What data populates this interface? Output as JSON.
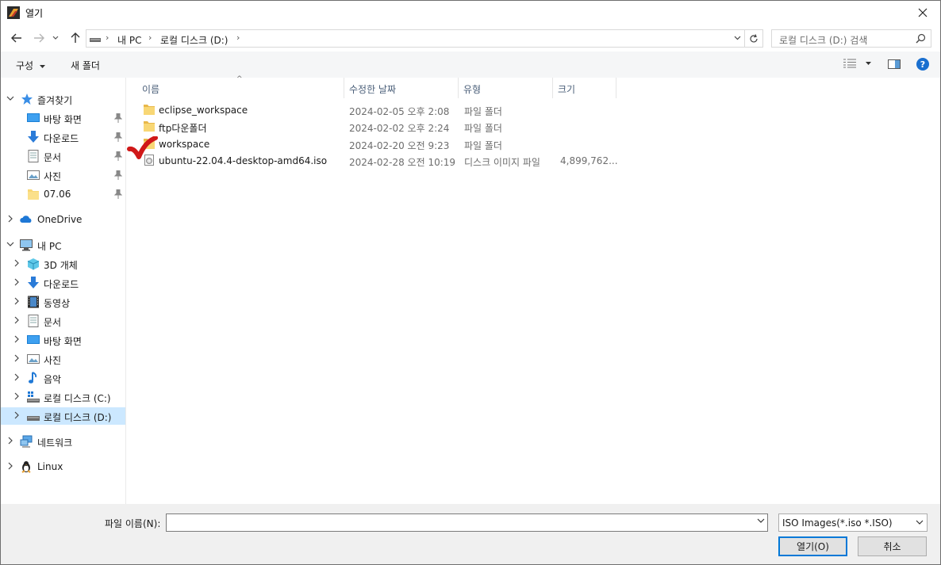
{
  "window": {
    "title": "열기"
  },
  "address": {
    "segments": [
      "내 PC",
      "로컬 디스크 (D:)"
    ]
  },
  "search": {
    "placeholder": "로컬 디스크 (D:) 검색"
  },
  "toolbar": {
    "organize": "구성",
    "new_folder": "새 폴더"
  },
  "sidebar": {
    "quick_access": "즐겨찾기",
    "quick_items": [
      "바탕 화면",
      "다운로드",
      "문서",
      "사진",
      "07.06"
    ],
    "onedrive": "OneDrive",
    "this_pc": "내 PC",
    "pc_items": [
      "3D 개체",
      "다운로드",
      "동영상",
      "문서",
      "바탕 화면",
      "사진",
      "음악",
      "로컬 디스크 (C:)",
      "로컬 디스크 (D:)"
    ],
    "network": "네트워크",
    "linux": "Linux"
  },
  "columns": {
    "name": "이름",
    "date": "수정한 날짜",
    "type": "유형",
    "size": "크기"
  },
  "files": [
    {
      "name": "eclipse_workspace",
      "date": "2024-02-05 오후 2:08",
      "type": "파일 폴더",
      "size": "",
      "icon": "folder-icon"
    },
    {
      "name": "ftp다운폴더",
      "date": "2024-02-02 오후 2:24",
      "type": "파일 폴더",
      "size": "",
      "icon": "folder-icon"
    },
    {
      "name": "workspace",
      "date": "2024-02-20 오전 9:23",
      "type": "파일 폴더",
      "size": "",
      "icon": "folder-icon"
    },
    {
      "name": "ubuntu-22.04.4-desktop-amd64.iso",
      "date": "2024-02-28 오전 10:19",
      "type": "디스크 이미지 파일",
      "size": "4,899,762...",
      "icon": "disc-image-icon"
    }
  ],
  "bottom": {
    "filename_label": "파일 이름(N):",
    "filename_value": "",
    "filter_value": "ISO Images(*.iso *.ISO)",
    "open_label": "열기(O)",
    "cancel_label": "취소"
  },
  "colors": {
    "accent": "#0078d7",
    "selected": "#cce8ff",
    "folder": "#f8d775"
  }
}
